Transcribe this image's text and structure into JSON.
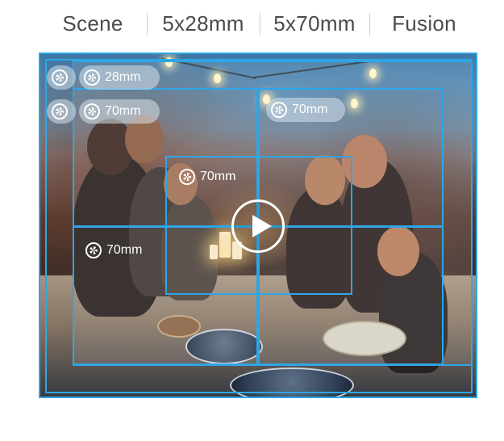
{
  "tabs": [
    {
      "label": "Scene"
    },
    {
      "label": "5x28mm"
    },
    {
      "label": "5x70mm"
    },
    {
      "label": "Fusion"
    }
  ],
  "badges": {
    "outer_top": "",
    "outer_second": "",
    "wide_28": "28mm",
    "tele_left": "70mm",
    "tele_right": "70mm",
    "tele_center": "70mm",
    "tele_bottom": "70mm"
  },
  "icons": {
    "aperture": "aperture-icon",
    "play": "play-icon"
  },
  "colors": {
    "frame_accent": "#2ea6e6",
    "tab_text": "#4a4a4a"
  }
}
